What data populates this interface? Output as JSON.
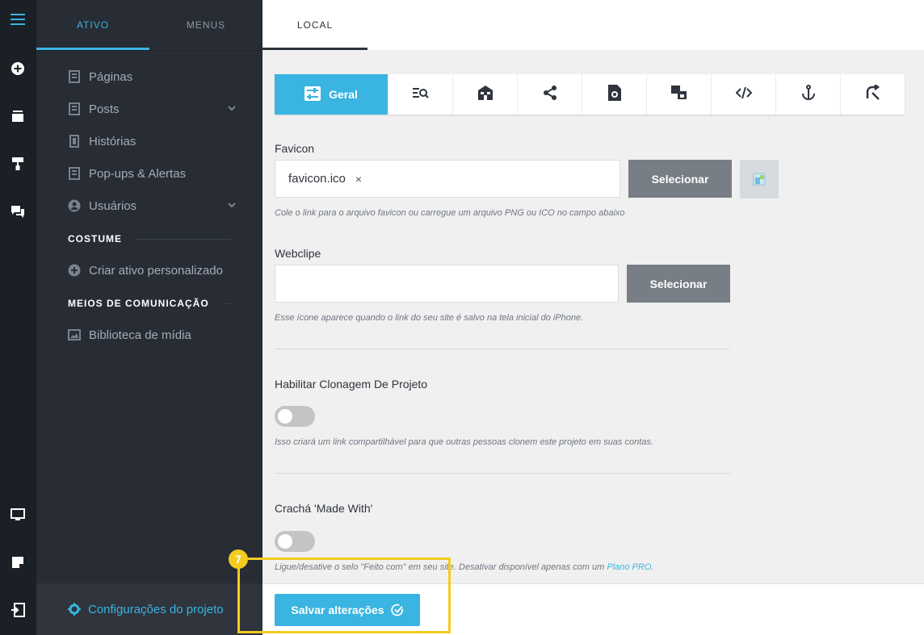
{
  "sidebar": {
    "tabs": [
      {
        "label": "ATIVO",
        "active": true
      },
      {
        "label": "MENUS",
        "active": false
      }
    ],
    "items": [
      {
        "label": "Páginas",
        "icon": "page-icon"
      },
      {
        "label": "Posts",
        "icon": "page-icon",
        "expandable": true
      },
      {
        "label": "Histórias",
        "icon": "story-icon"
      },
      {
        "label": "Pop-ups & Alertas",
        "icon": "page-icon"
      },
      {
        "label": "Usuários",
        "icon": "user-icon",
        "expandable": true
      }
    ],
    "custom_section": {
      "heading": "COSTUME",
      "items": [
        {
          "label": "Criar ativo personalizado",
          "icon": "add-circle-icon"
        }
      ]
    },
    "media_section": {
      "heading": "MEIOS DE COMUNICAÇÃO",
      "items": [
        {
          "label": "Biblioteca de mídia",
          "icon": "image-icon"
        }
      ]
    },
    "settings_label": "Configurações do projeto"
  },
  "main": {
    "tab_label": "LOCAL",
    "toolbar": {
      "active_label": "Geral",
      "icons": [
        "general-settings-icon",
        "seo-icon",
        "storefront-icon",
        "share-icon",
        "file-settings-icon",
        "translate-icon",
        "code-icon",
        "anchor-icon",
        "redirect-icon"
      ]
    },
    "favicon": {
      "label": "Favicon",
      "value": "favicon.ico",
      "clear": "×",
      "button": "Selecionar",
      "help": "Cole o link para o arquivo favicon ou carregue um arquivo PNG ou ICO no campo abaixo"
    },
    "webclip": {
      "label": "Webclipe",
      "value": "",
      "button": "Selecionar",
      "help": "Esse ícone aparece quando o link do seu site é salvo na tela inicial do iPhone."
    },
    "cloning": {
      "label": "Habilitar Clonagem De Projeto",
      "enabled": false,
      "help": "Isso criará um link compartilhável para que outras pessoas clonem este projeto em suas contas."
    },
    "made_with": {
      "label": "Crachá 'Made With'",
      "enabled": false,
      "help": "Ligue/desative o selo \"Feito com\" em seu site. Desativar disponível apenas com um ",
      "link": "Plano PRO",
      "help_end": "."
    },
    "save_label": "Salvar alterações"
  },
  "tutorial": {
    "step": "7"
  },
  "colors": {
    "accent": "#3ab4e0",
    "sidebar": "#272c35",
    "rail": "#1b1f26",
    "highlight": "#f2cc1f"
  }
}
